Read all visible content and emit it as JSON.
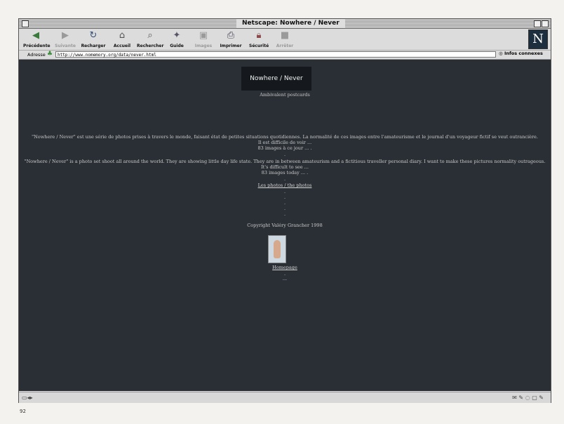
{
  "window": {
    "title": "Netscape: Nowhere / Never"
  },
  "toolbar": {
    "buttons": [
      {
        "label": "Précédente",
        "icon": "back-arrow-icon"
      },
      {
        "label": "Suivante",
        "icon": "forward-arrow-icon"
      },
      {
        "label": "Recharger",
        "icon": "reload-icon"
      },
      {
        "label": "Accueil",
        "icon": "home-icon"
      },
      {
        "label": "Rechercher",
        "icon": "search-icon"
      },
      {
        "label": "Guide",
        "icon": "guide-icon"
      },
      {
        "label": "Images",
        "icon": "images-icon"
      },
      {
        "label": "Imprimer",
        "icon": "print-icon"
      },
      {
        "label": "Sécurité",
        "icon": "security-lock-icon"
      },
      {
        "label": "Arrêter",
        "icon": "stop-icon"
      }
    ],
    "logo": "N"
  },
  "location": {
    "label": "Adresse",
    "url": "http://www.nomemory.org/data/never.html",
    "related_label": "Infos connexes"
  },
  "page": {
    "title": "Nowhere / Never",
    "subtitle": "Ambivalent postcards",
    "fr_text": "\"Nowhere / Never\" est une série de photos prises à travers le monde, faisant état de petites situations quotidiennes. La normalité de ces images entre l'amateurisme et le journal d'un voyageur fictif se veut outrancière.",
    "fr_line2": "Il est difficile de voir ...",
    "fr_line3": "83 images à ce jour ... .",
    "en_text": "\"Nowhere / Never\" is a photo set shoot all around the world. They are showing little day life state. They are in between amateurism and a fictitious traveller personal diary. I want to make these pictures normality outrageous.",
    "en_line2": "It's difficult to see ...",
    "en_line3": "83 images today ... .",
    "photos_link": "Les photos / the photos",
    "copyright": "Copyright Valéry Grancher 1998",
    "homepage_link": "Homepage",
    "dot": ".",
    "ellipsis": "..."
  },
  "book": {
    "page_number": "92"
  }
}
